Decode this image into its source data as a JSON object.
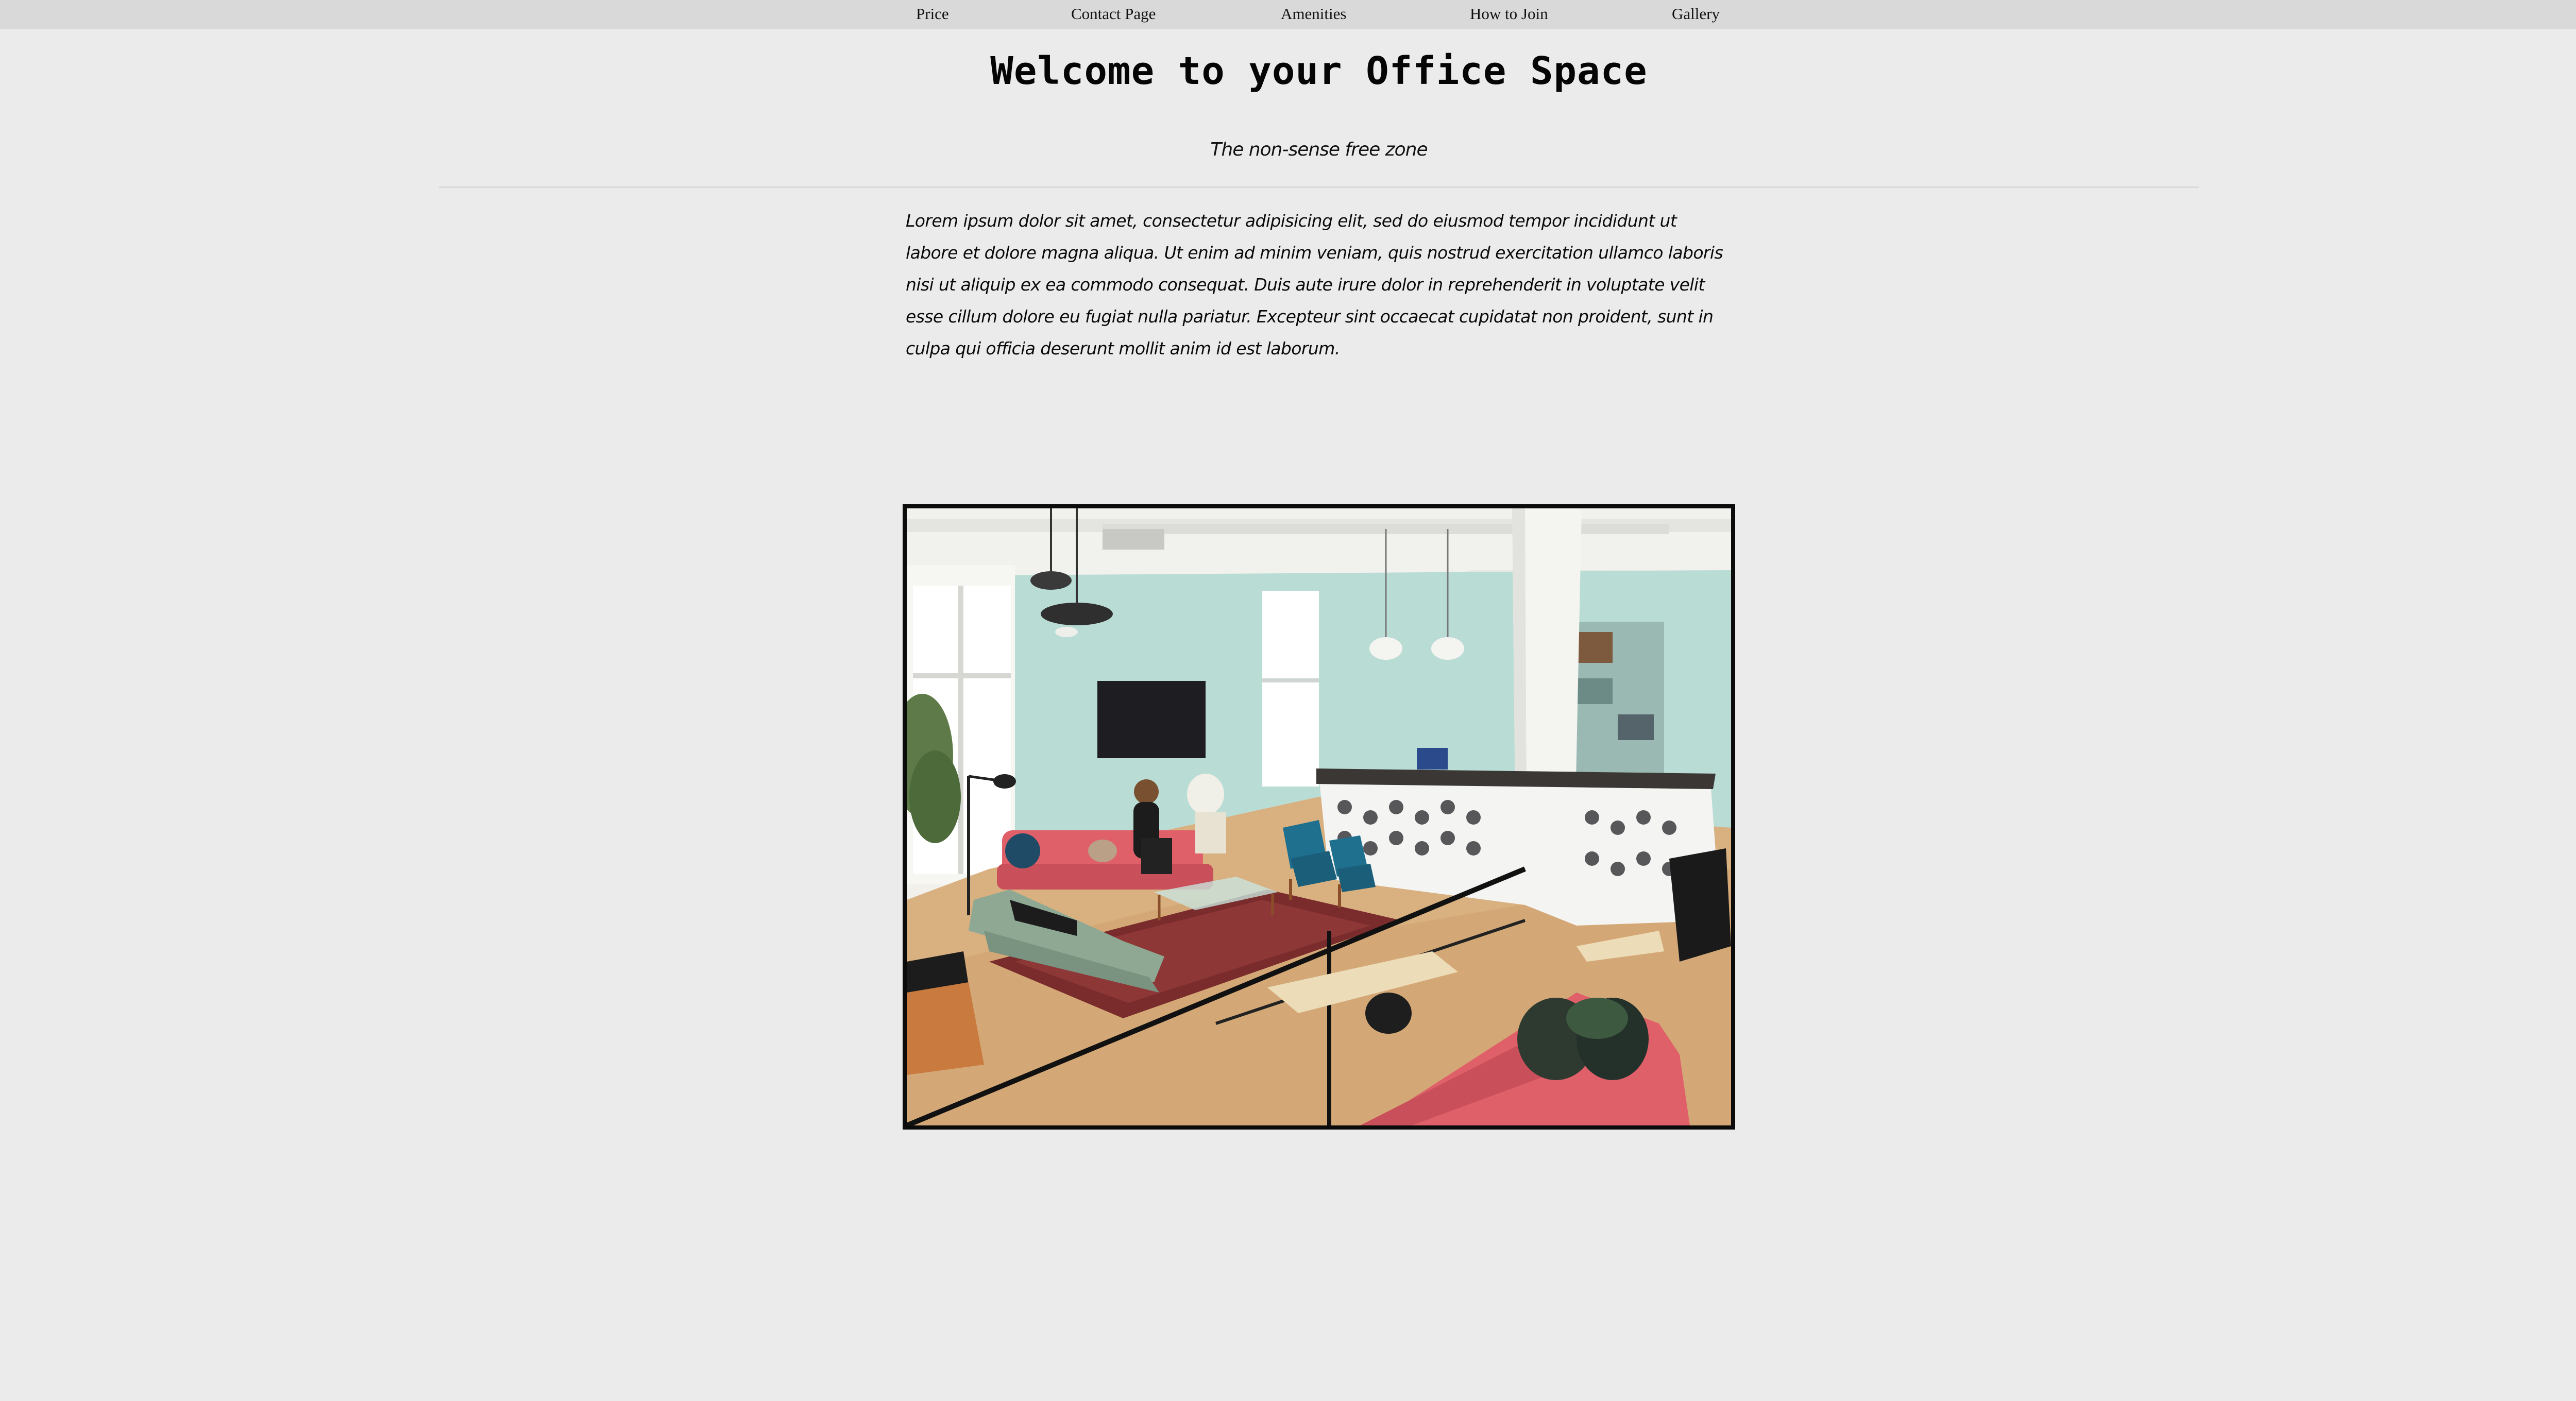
{
  "nav": {
    "items": [
      {
        "label": "Price",
        "key": "price"
      },
      {
        "label": "Contact Page",
        "key": "contact"
      },
      {
        "label": "Amenities",
        "key": "amenities"
      },
      {
        "label": "How to Join",
        "key": "join"
      },
      {
        "label": "Gallery",
        "key": "gallery"
      }
    ]
  },
  "header": {
    "title": "Welcome to your Office Space",
    "subtitle": "The non-sense free zone"
  },
  "intro": {
    "text": "Lorem ipsum dolor sit amet, consectetur adipisicing elit, sed do eiusmod tempor incididunt ut labore et dolore magna aliqua. Ut enim ad minim veniam, quis nostrud exercitation ullamco laboris nisi ut aliquip ex ea commodo consequat. Duis aute irure dolor in reprehenderit in voluptate velit esse cillum dolore eu fugiat nulla pariatur. Excepteur sint occaecat cupidatat non proident, sunt in culpa qui officia deserunt mollit anim id est laborum."
  },
  "colors": {
    "page_bg": "#ebebeb",
    "nav_bg": "#d9d9d9",
    "frame_border": "#0b0b0b",
    "wall_mint": "#b9dcd4",
    "sofa_coral": "#e0606a",
    "chair_teal": "#1f6f8f",
    "floor_oak": "#d9b080"
  }
}
